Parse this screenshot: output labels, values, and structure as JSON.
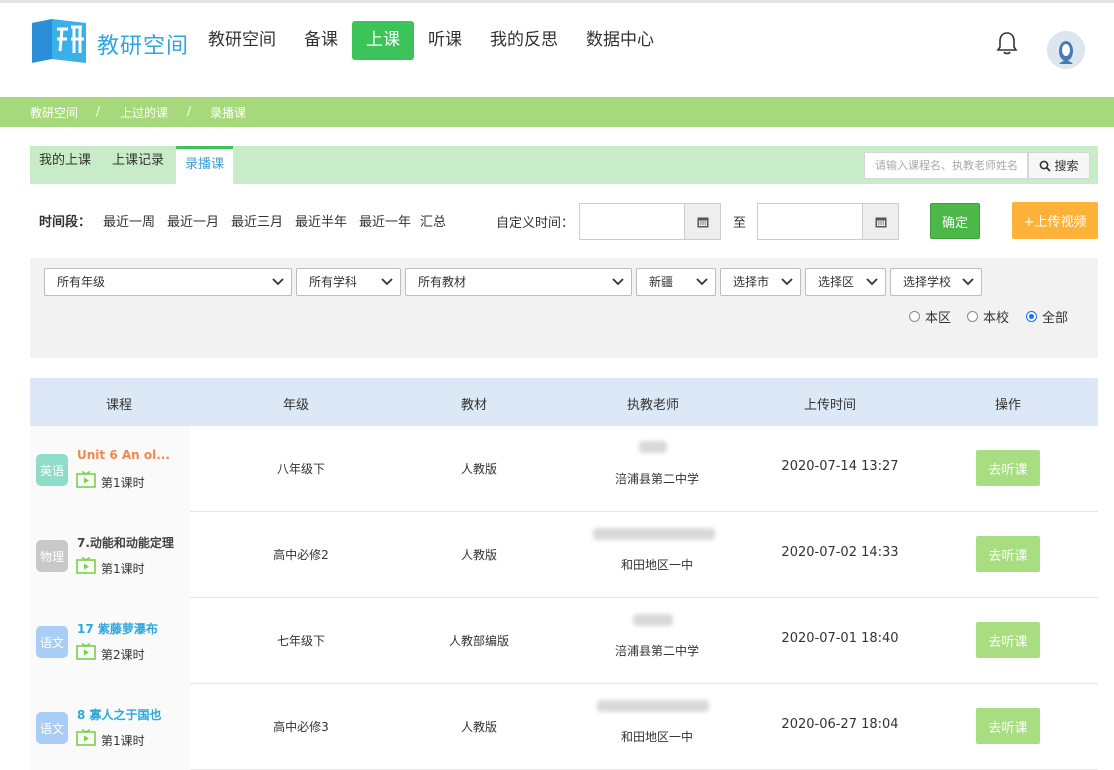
{
  "app": {
    "logo_text": "教研空间",
    "nav": [
      {
        "label": "教研空间",
        "active": false
      },
      {
        "label": "备课",
        "active": false
      },
      {
        "label": "上课",
        "active": true
      },
      {
        "label": "听课",
        "active": false
      },
      {
        "label": "我的反思",
        "active": false
      },
      {
        "label": "数据中心",
        "active": false
      }
    ],
    "accent": "#3cc35a",
    "brand_blue": "#2ea7e0"
  },
  "breadcrumb": [
    "教研空间",
    "上过的课",
    "录播课"
  ],
  "breadcrumb_sep": "/",
  "tabs": [
    {
      "label": "我的上课",
      "active": false
    },
    {
      "label": "上课记录",
      "active": false
    },
    {
      "label": "录播课",
      "active": true
    }
  ],
  "search": {
    "placeholder": "请输入课程名、执教老师姓名",
    "button_label": "搜索"
  },
  "time_filter": {
    "label": "时间段：",
    "options": [
      "最近一周",
      "最近一月",
      "最近三月",
      "最近半年",
      "最近一年",
      "汇总"
    ],
    "custom_label": "自定义时间：",
    "to_label": "至",
    "start_value": "",
    "end_value": ""
  },
  "buttons": {
    "confirm": "确定",
    "upload": "+上传视频"
  },
  "filters": {
    "grade": "所有年级",
    "subject": "所有学科",
    "textbook": "所有教材",
    "province": "新疆",
    "city": "选择市",
    "district": "选择区",
    "school": "选择学校"
  },
  "scope": {
    "options": [
      "本区",
      "本校",
      "全部"
    ],
    "selected": "全部"
  },
  "table": {
    "headers": [
      "课程",
      "年级",
      "教材",
      "执教老师",
      "上传时间",
      "操作"
    ],
    "rows": [
      {
        "subject": "英语",
        "subject_color": "#8fdcc8",
        "title": "Unit 6 An ol...",
        "title_color": "#f08a4b",
        "period": "第1课时",
        "grade": "八年级下",
        "textbook": "人教版",
        "school": "涪浦县第二中学",
        "time": "2020-07-14 13:27",
        "action": "去听课"
      },
      {
        "subject": "物理",
        "subject_color": "#c8c8c8",
        "title": "7.动能和动能定理",
        "title_color": "#444444",
        "period": "第1课时",
        "grade": "高中必修2",
        "textbook": "人教版",
        "school": "和田地区一中",
        "time": "2020-07-02 14:33",
        "action": "去听课"
      },
      {
        "subject": "语文",
        "subject_color": "#a9cdf5",
        "title": "17 紫藤萝瀑布",
        "title_color": "#2ea7e0",
        "period": "第2课时",
        "grade": "七年级下",
        "textbook": "人教部编版",
        "school": "涪浦县第二中学",
        "time": "2020-07-01 18:40",
        "action": "去听课"
      },
      {
        "subject": "语文",
        "subject_color": "#a9cdf5",
        "title": "8 寡人之于国也",
        "title_color": "#2ea7e0",
        "period": "第1课时",
        "grade": "高中必修3",
        "textbook": "人教版",
        "school": "和田地区一中",
        "time": "2020-06-27 18:04",
        "action": "去听课"
      }
    ]
  }
}
